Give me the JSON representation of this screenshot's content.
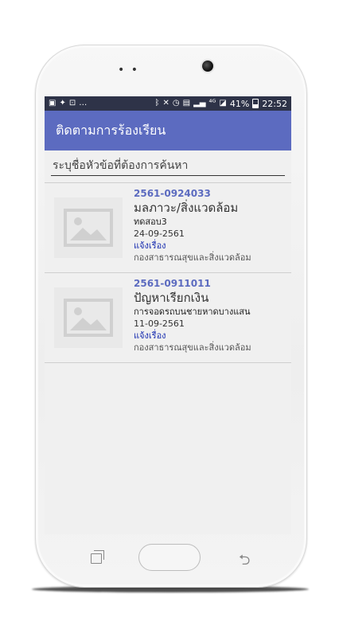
{
  "status_bar": {
    "left_icons": [
      "image-icon",
      "twitter-icon",
      "bus-icon",
      "..."
    ],
    "right_icons": [
      "bluetooth-icon",
      "mute-icon",
      "alarm-icon",
      "sim-icon",
      "signal-icon",
      "4g-icon",
      "signal-icon"
    ],
    "battery_text": "41%",
    "time": "22:52"
  },
  "appbar": {
    "title": "ติดตามการร้องเรียน"
  },
  "search": {
    "placeholder": "ระบุชื่อหัวข้อที่ต้องการค้นหา",
    "value": ""
  },
  "items": [
    {
      "code": "2561-0924033",
      "title": "มลภาวะ/สิ่งแวดล้อม",
      "detail": "ทดสอบ3",
      "date": "24-09-2561",
      "status": "แจ้งเรื่อง",
      "department": "กองสาธารณสุขและสิ่งแวดล้อม"
    },
    {
      "code": "2561-0911011",
      "title": "ปัญหาเรียกเงิน",
      "detail": "การจอดรถบนชายหาดบางแสน",
      "date": "11-09-2561",
      "status": "แจ้งเรื่อง",
      "department": "กองสาธารณสุขและสิ่งแวดล้อม"
    }
  ],
  "colors": {
    "appbar": "#5c6bc0",
    "statusbar": "#2e3348",
    "code": "#5c6bc0",
    "status": "#1a2fb0"
  }
}
